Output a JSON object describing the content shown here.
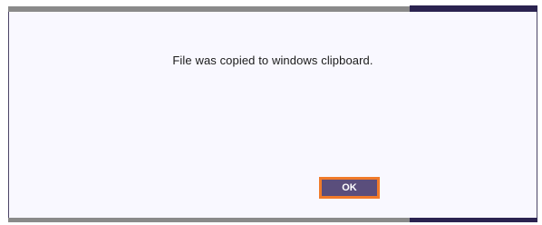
{
  "dialog": {
    "message": "File was copied to windows clipboard.",
    "ok_label": "OK"
  },
  "colors": {
    "dialog_background": "#f9f8ff",
    "title_bar_gray": "#8a8a8a",
    "title_bar_dark": "#2b2350",
    "button_fill": "#5a4e7c",
    "button_focus_border": "#f07a2a",
    "text": "#1b1b1b"
  }
}
